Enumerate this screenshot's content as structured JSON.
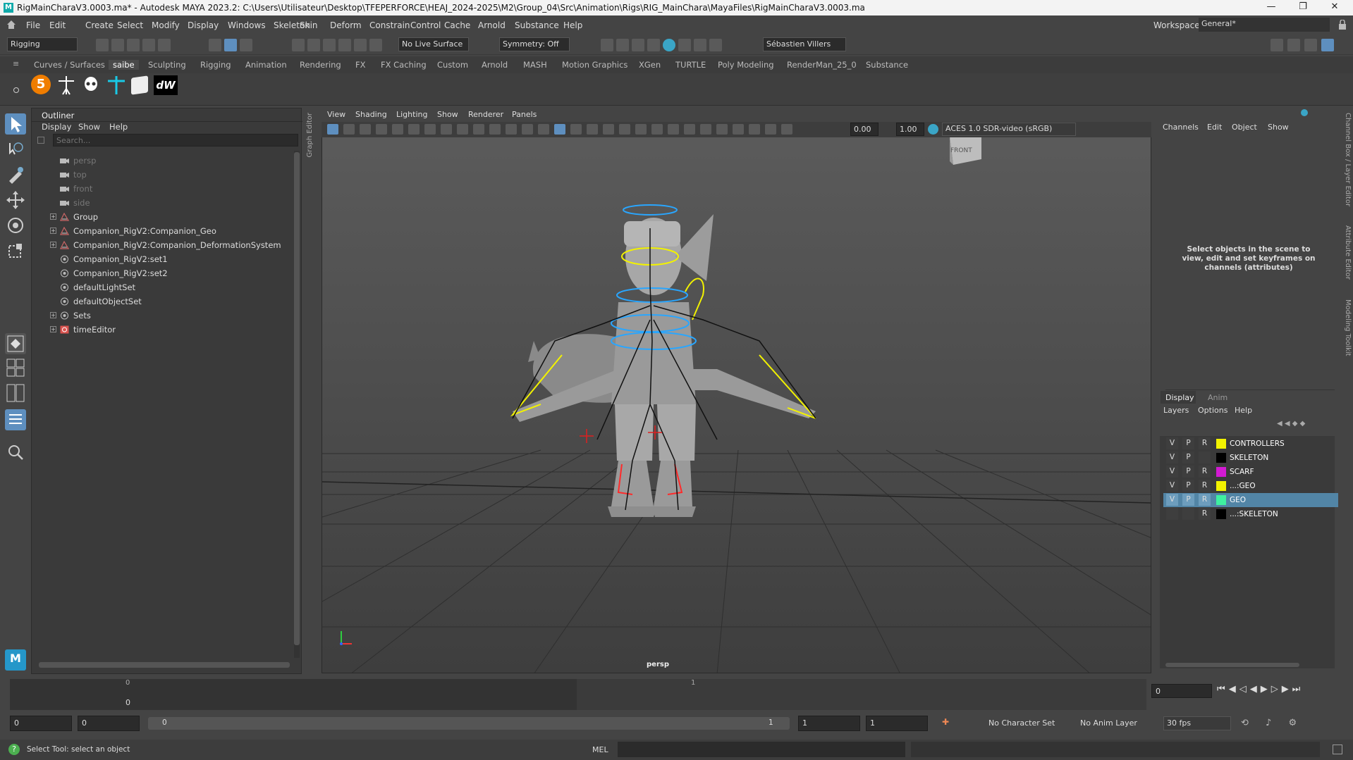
{
  "window": {
    "title": "RigMainCharaV3.0003.ma* - Autodesk MAYA 2023.2: C:\\Users\\Utilisateur\\Desktop\\TFEPERFORCE\\HEAJ_2024-2025\\M2\\Group_04\\Src\\Animation\\Rigs\\RIG_MainChara\\MayaFiles\\RigMainCharaV3.0003.ma",
    "minimize": "—",
    "maximize": "❐",
    "close": "✕"
  },
  "menu": [
    "File",
    "Edit",
    "Create",
    "Select",
    "Modify",
    "Display",
    "Windows",
    "Skeleton",
    "Skin",
    "Deform",
    "Constrain",
    "Control",
    "Cache",
    "Arnold",
    "Substance",
    "Help"
  ],
  "workspace": {
    "label": "Workspace:",
    "value": "General*"
  },
  "toolbar": {
    "mode": "Rigging",
    "live": "No Live Surface",
    "symmetry": "Symmetry: Off",
    "user": "Sébastien Villers"
  },
  "shelf_tabs": [
    "Curves / Surfaces",
    "saibe",
    "Sculpting",
    "Rigging",
    "Animation",
    "Rendering",
    "FX",
    "FX Caching",
    "Custom",
    "Arnold",
    "MASH",
    "Motion Graphics",
    "XGen",
    "TURTLE",
    "Poly Modeling",
    "RenderMan_25_0",
    "Substance"
  ],
  "shelf_active": "saibe",
  "outliner": {
    "title": "Outliner",
    "menus": [
      "Display",
      "Show",
      "Help"
    ],
    "search_placeholder": "Search...",
    "items": [
      {
        "label": "persp",
        "dim": true,
        "icon": "camera-icon",
        "expand": false
      },
      {
        "label": "top",
        "dim": true,
        "icon": "camera-icon",
        "expand": false
      },
      {
        "label": "front",
        "dim": true,
        "icon": "camera-icon",
        "expand": false
      },
      {
        "label": "side",
        "dim": true,
        "icon": "camera-icon",
        "expand": false
      },
      {
        "label": "Group",
        "dim": false,
        "icon": "group-icon",
        "expand": true
      },
      {
        "label": "Companion_RigV2:Companion_Geo",
        "dim": false,
        "icon": "group-icon",
        "expand": true
      },
      {
        "label": "Companion_RigV2:Companion_DeformationSystem",
        "dim": false,
        "icon": "group-icon",
        "expand": true
      },
      {
        "label": "Companion_RigV2:set1",
        "dim": false,
        "icon": "set-icon",
        "expand": false
      },
      {
        "label": "Companion_RigV2:set2",
        "dim": false,
        "icon": "set-icon",
        "expand": false
      },
      {
        "label": "defaultLightSet",
        "dim": false,
        "icon": "set-icon",
        "expand": false
      },
      {
        "label": "defaultObjectSet",
        "dim": false,
        "icon": "set-icon",
        "expand": false
      },
      {
        "label": "Sets",
        "dim": false,
        "icon": "set-icon",
        "expand": true
      },
      {
        "label": "timeEditor",
        "dim": false,
        "icon": "time-editor-icon",
        "expand": true
      }
    ]
  },
  "graph_editor_tab": "Graph Editor",
  "viewport": {
    "menus": [
      "View",
      "Shading",
      "Lighting",
      "Show",
      "Renderer",
      "Panels"
    ],
    "exposure": "0.00",
    "gamma": "1.00",
    "colorspace": "ACES 1.0 SDR-video (sRGB)",
    "cube": "FRONT",
    "camera": "persp"
  },
  "channelbox": {
    "menus": [
      "Channels",
      "Edit",
      "Object",
      "Show"
    ],
    "hint": "Select objects in the scene to view, edit and set keyframes on channels (attributes)"
  },
  "side_tabs": [
    "Channel Box / Layer Editor",
    "Attribute Editor",
    "Modeling Toolkit"
  ],
  "layers": {
    "tabs": [
      "Display",
      "Anim"
    ],
    "menus": [
      "Layers",
      "Options",
      "Help"
    ],
    "rows": [
      {
        "v": "V",
        "p": "P",
        "r": "R",
        "name": "CONTROLLERS",
        "color": "#f2f200",
        "selected": false
      },
      {
        "v": "V",
        "p": "P",
        "r": "",
        "name": "SKELETON",
        "color": "#000000",
        "selected": false
      },
      {
        "v": "V",
        "p": "P",
        "r": "R",
        "name": "SCARF",
        "color": "#d21ad2",
        "selected": false
      },
      {
        "v": "V",
        "p": "P",
        "r": "R",
        "name": "...:GEO",
        "color": "#f2f200",
        "selected": false
      },
      {
        "v": "V",
        "p": "P",
        "r": "R",
        "name": "GEO",
        "color": "#3ef0a0",
        "selected": true
      },
      {
        "v": "",
        "p": "",
        "r": "R",
        "name": "...:SKELETON",
        "color": "#000000",
        "selected": false
      }
    ]
  },
  "timeline": {
    "tick0": "0",
    "tick1": "1",
    "frame_below": "0",
    "current": "0"
  },
  "range": {
    "start": "0",
    "start2": "0",
    "slider_start": "0",
    "slider_end": "1",
    "end": "1",
    "end2": "1",
    "char_set": "No Character Set",
    "anim_layer": "No Anim Layer",
    "fps": "30 fps"
  },
  "status": {
    "help": "Select Tool: select an object",
    "mel": "MEL"
  }
}
